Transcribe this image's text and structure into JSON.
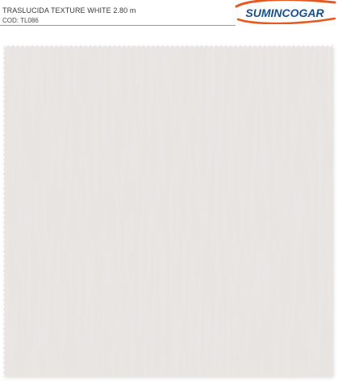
{
  "header": {
    "product_title": "TRASLUCIDA TEXTURE WHITE 2.80 m",
    "product_code": "COD: TL086"
  },
  "logo": {
    "text": "SUMINCOGAR",
    "accent_color": "#e8581e",
    "text_color": "#1b4f8c"
  },
  "swatch": {
    "fabric_color": "#eae7e5",
    "shadow_color": "#d8d4d1"
  }
}
